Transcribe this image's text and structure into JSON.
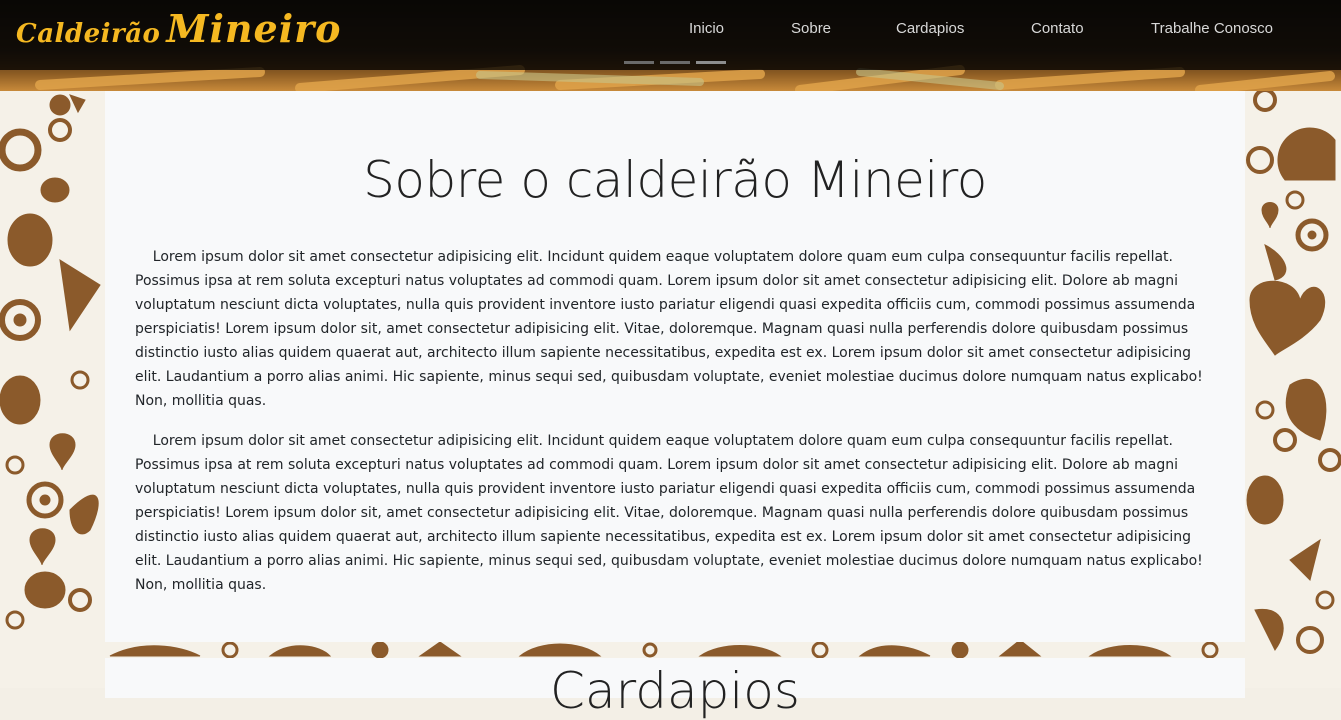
{
  "brand": {
    "part1": "Caldeirão",
    "part2": "Mineiro",
    "color": "#f5b821"
  },
  "nav": {
    "items": [
      {
        "label": "Inicio"
      },
      {
        "label": "Sobre"
      },
      {
        "label": "Cardapios"
      },
      {
        "label": "Contato"
      },
      {
        "label": "Trabalhe Conosco"
      }
    ]
  },
  "carousel": {
    "indicator_count": 3,
    "active_index": 2
  },
  "about": {
    "title": "Sobre o caldeirão Mineiro",
    "paragraphs": [
      "    Lorem ipsum dolor sit amet consectetur adipisicing elit. Incidunt quidem eaque voluptatem dolore quam eum culpa consequuntur facilis repellat. Possimus ipsa at rem soluta excepturi natus voluptates ad commodi quam. Lorem ipsum dolor sit amet consectetur adipisicing elit. Dolore ab magni voluptatum nesciunt dicta voluptates, nulla quis provident inventore iusto pariatur eligendi quasi expedita officiis cum, commodi possimus assumenda perspiciatis! Lorem ipsum dolor sit, amet consectetur adipisicing elit. Vitae, doloremque. Magnam quasi nulla perferendis dolore quibusdam possimus distinctio iusto alias quidem quaerat aut, architecto illum sapiente necessitatibus, expedita est ex. Lorem ipsum dolor sit amet consectetur adipisicing elit. Laudantium a porro alias animi. Hic sapiente, minus sequi sed, quibusdam voluptate, eveniet molestiae ducimus dolore numquam natus explicabo! Non, mollitia quas.",
      "    Lorem ipsum dolor sit amet consectetur adipisicing elit. Incidunt quidem eaque voluptatem dolore quam eum culpa consequuntur facilis repellat. Possimus ipsa at rem soluta excepturi natus voluptates ad commodi quam. Lorem ipsum dolor sit amet consectetur adipisicing elit. Dolore ab magni voluptatum nesciunt dicta voluptates, nulla quis provident inventore iusto pariatur eligendi quasi expedita officiis cum, commodi possimus assumenda perspiciatis! Lorem ipsum dolor sit, amet consectetur adipisicing elit. Vitae, doloremque. Magnam quasi nulla perferendis dolore quibusdam possimus distinctio iusto alias quidem quaerat aut, architecto illum sapiente necessitatibus, expedita est ex. Lorem ipsum dolor sit amet consectetur adipisicing elit. Laudantium a porro alias animi. Hic sapiente, minus sequi sed, quibusdam voluptate, eveniet molestiae ducimus dolore numquam natus explicabo! Non, mollitia quas."
    ]
  },
  "menu_section": {
    "title": "Cardapios"
  },
  "colors": {
    "pattern_brown": "#8b5a2b",
    "card_bg": "#f8f9fa",
    "navbar_bg": "#000000"
  }
}
